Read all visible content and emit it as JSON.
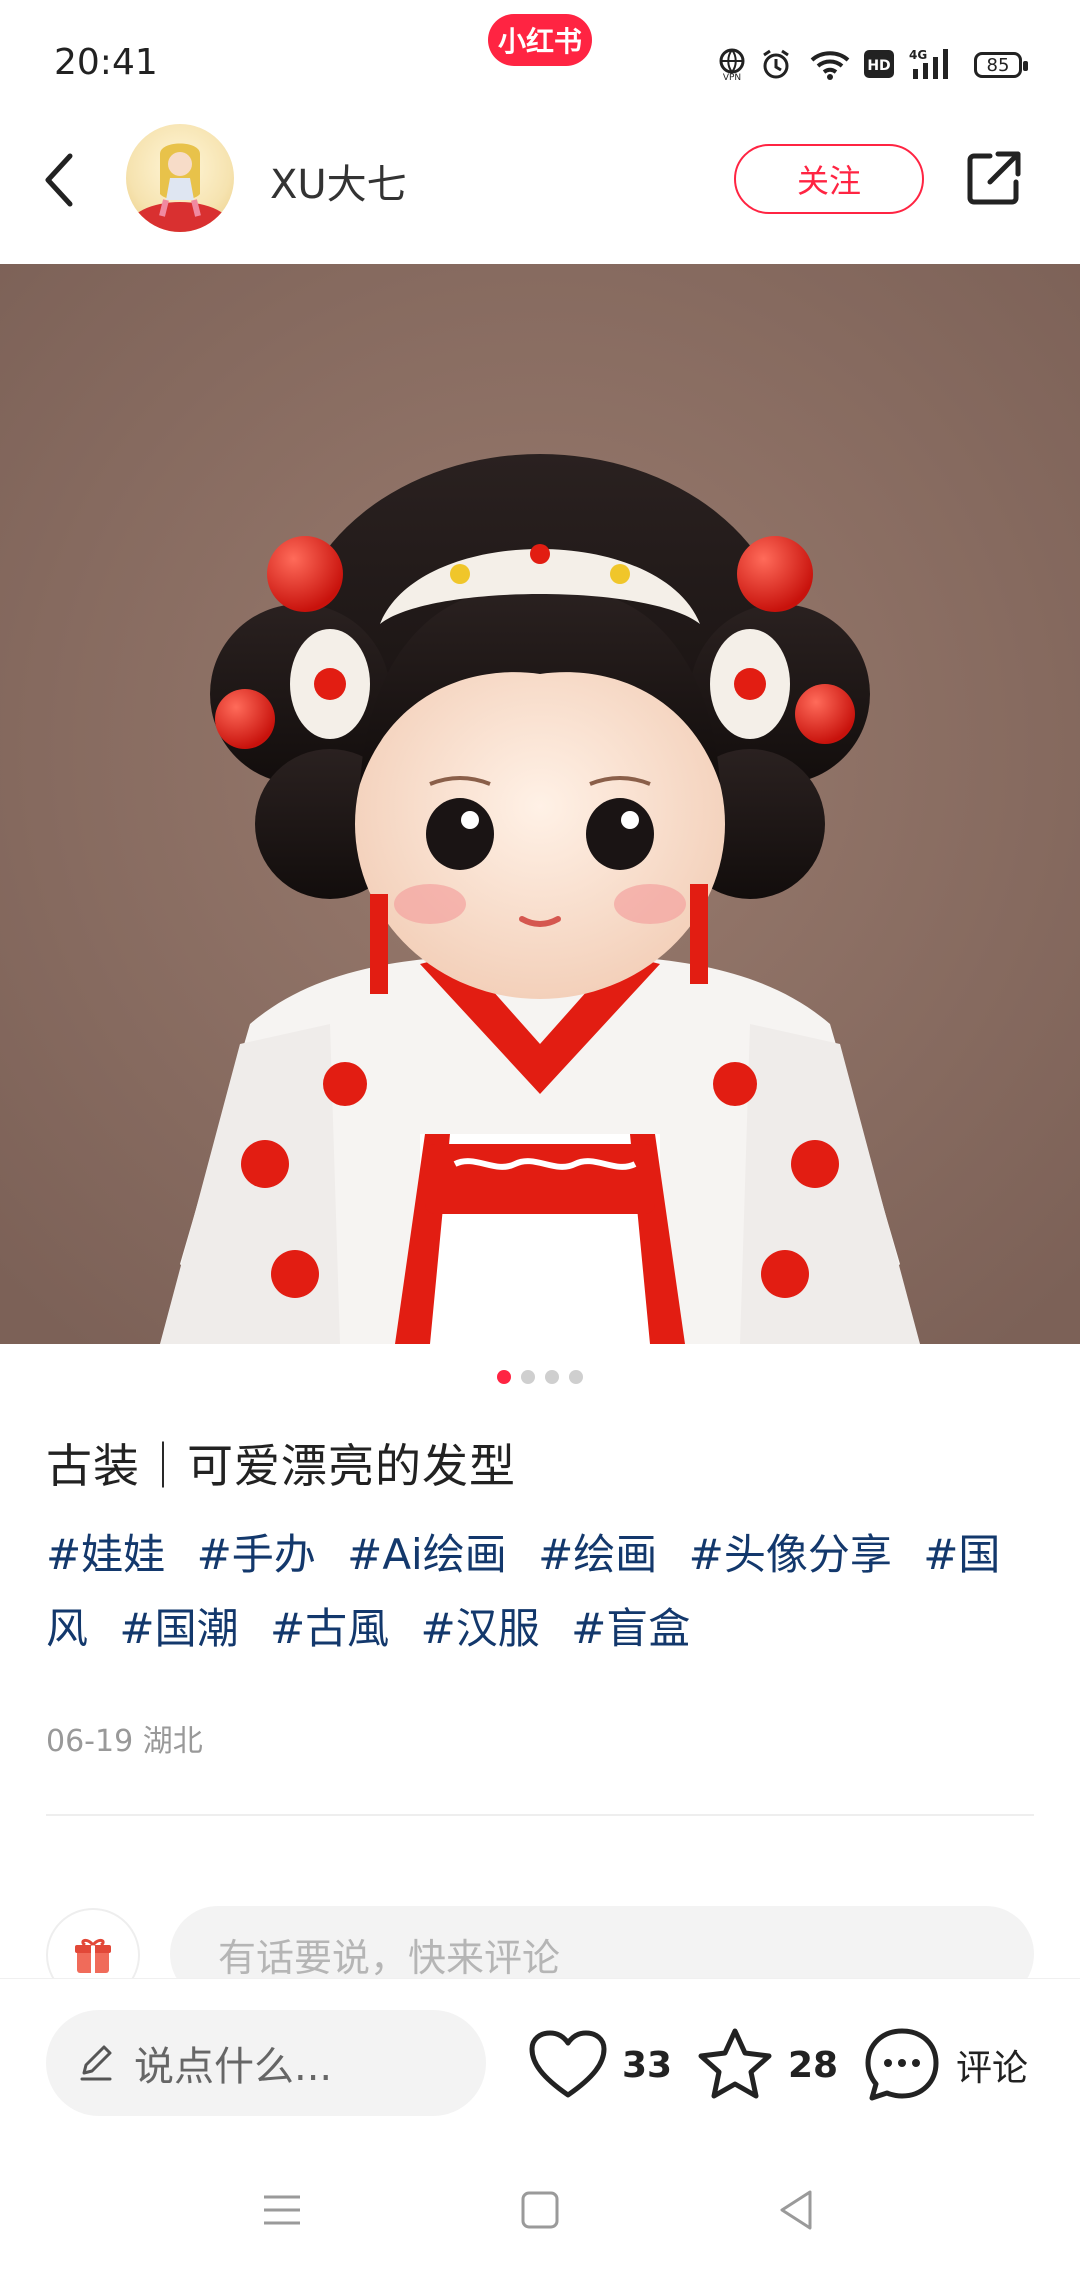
{
  "status_bar": {
    "time": "20:41",
    "app_badge": "小红书",
    "vpn": "VPN",
    "hd": "HD",
    "network": "4G",
    "battery": "85"
  },
  "header": {
    "author_name": "XU大七",
    "follow_label": "关注"
  },
  "carousel": {
    "total": 4,
    "active_index": 0
  },
  "post": {
    "title": "古装｜可爱漂亮的发型",
    "tags": [
      "#娃娃",
      "#手办",
      "#Ai绘画",
      "#绘画",
      "#头像分享",
      "#国风",
      "#国潮",
      "#古風",
      "#汉服",
      "#盲盒"
    ],
    "date_location": "06-19 湖北"
  },
  "comments": {
    "placeholder": "有话要说，快来评论"
  },
  "bottom_bar": {
    "say_placeholder": "说点什么...",
    "likes": "33",
    "favorites": "28",
    "comment_label": "评论"
  },
  "colors": {
    "brand": "#ff2442",
    "tag": "#13386c"
  }
}
